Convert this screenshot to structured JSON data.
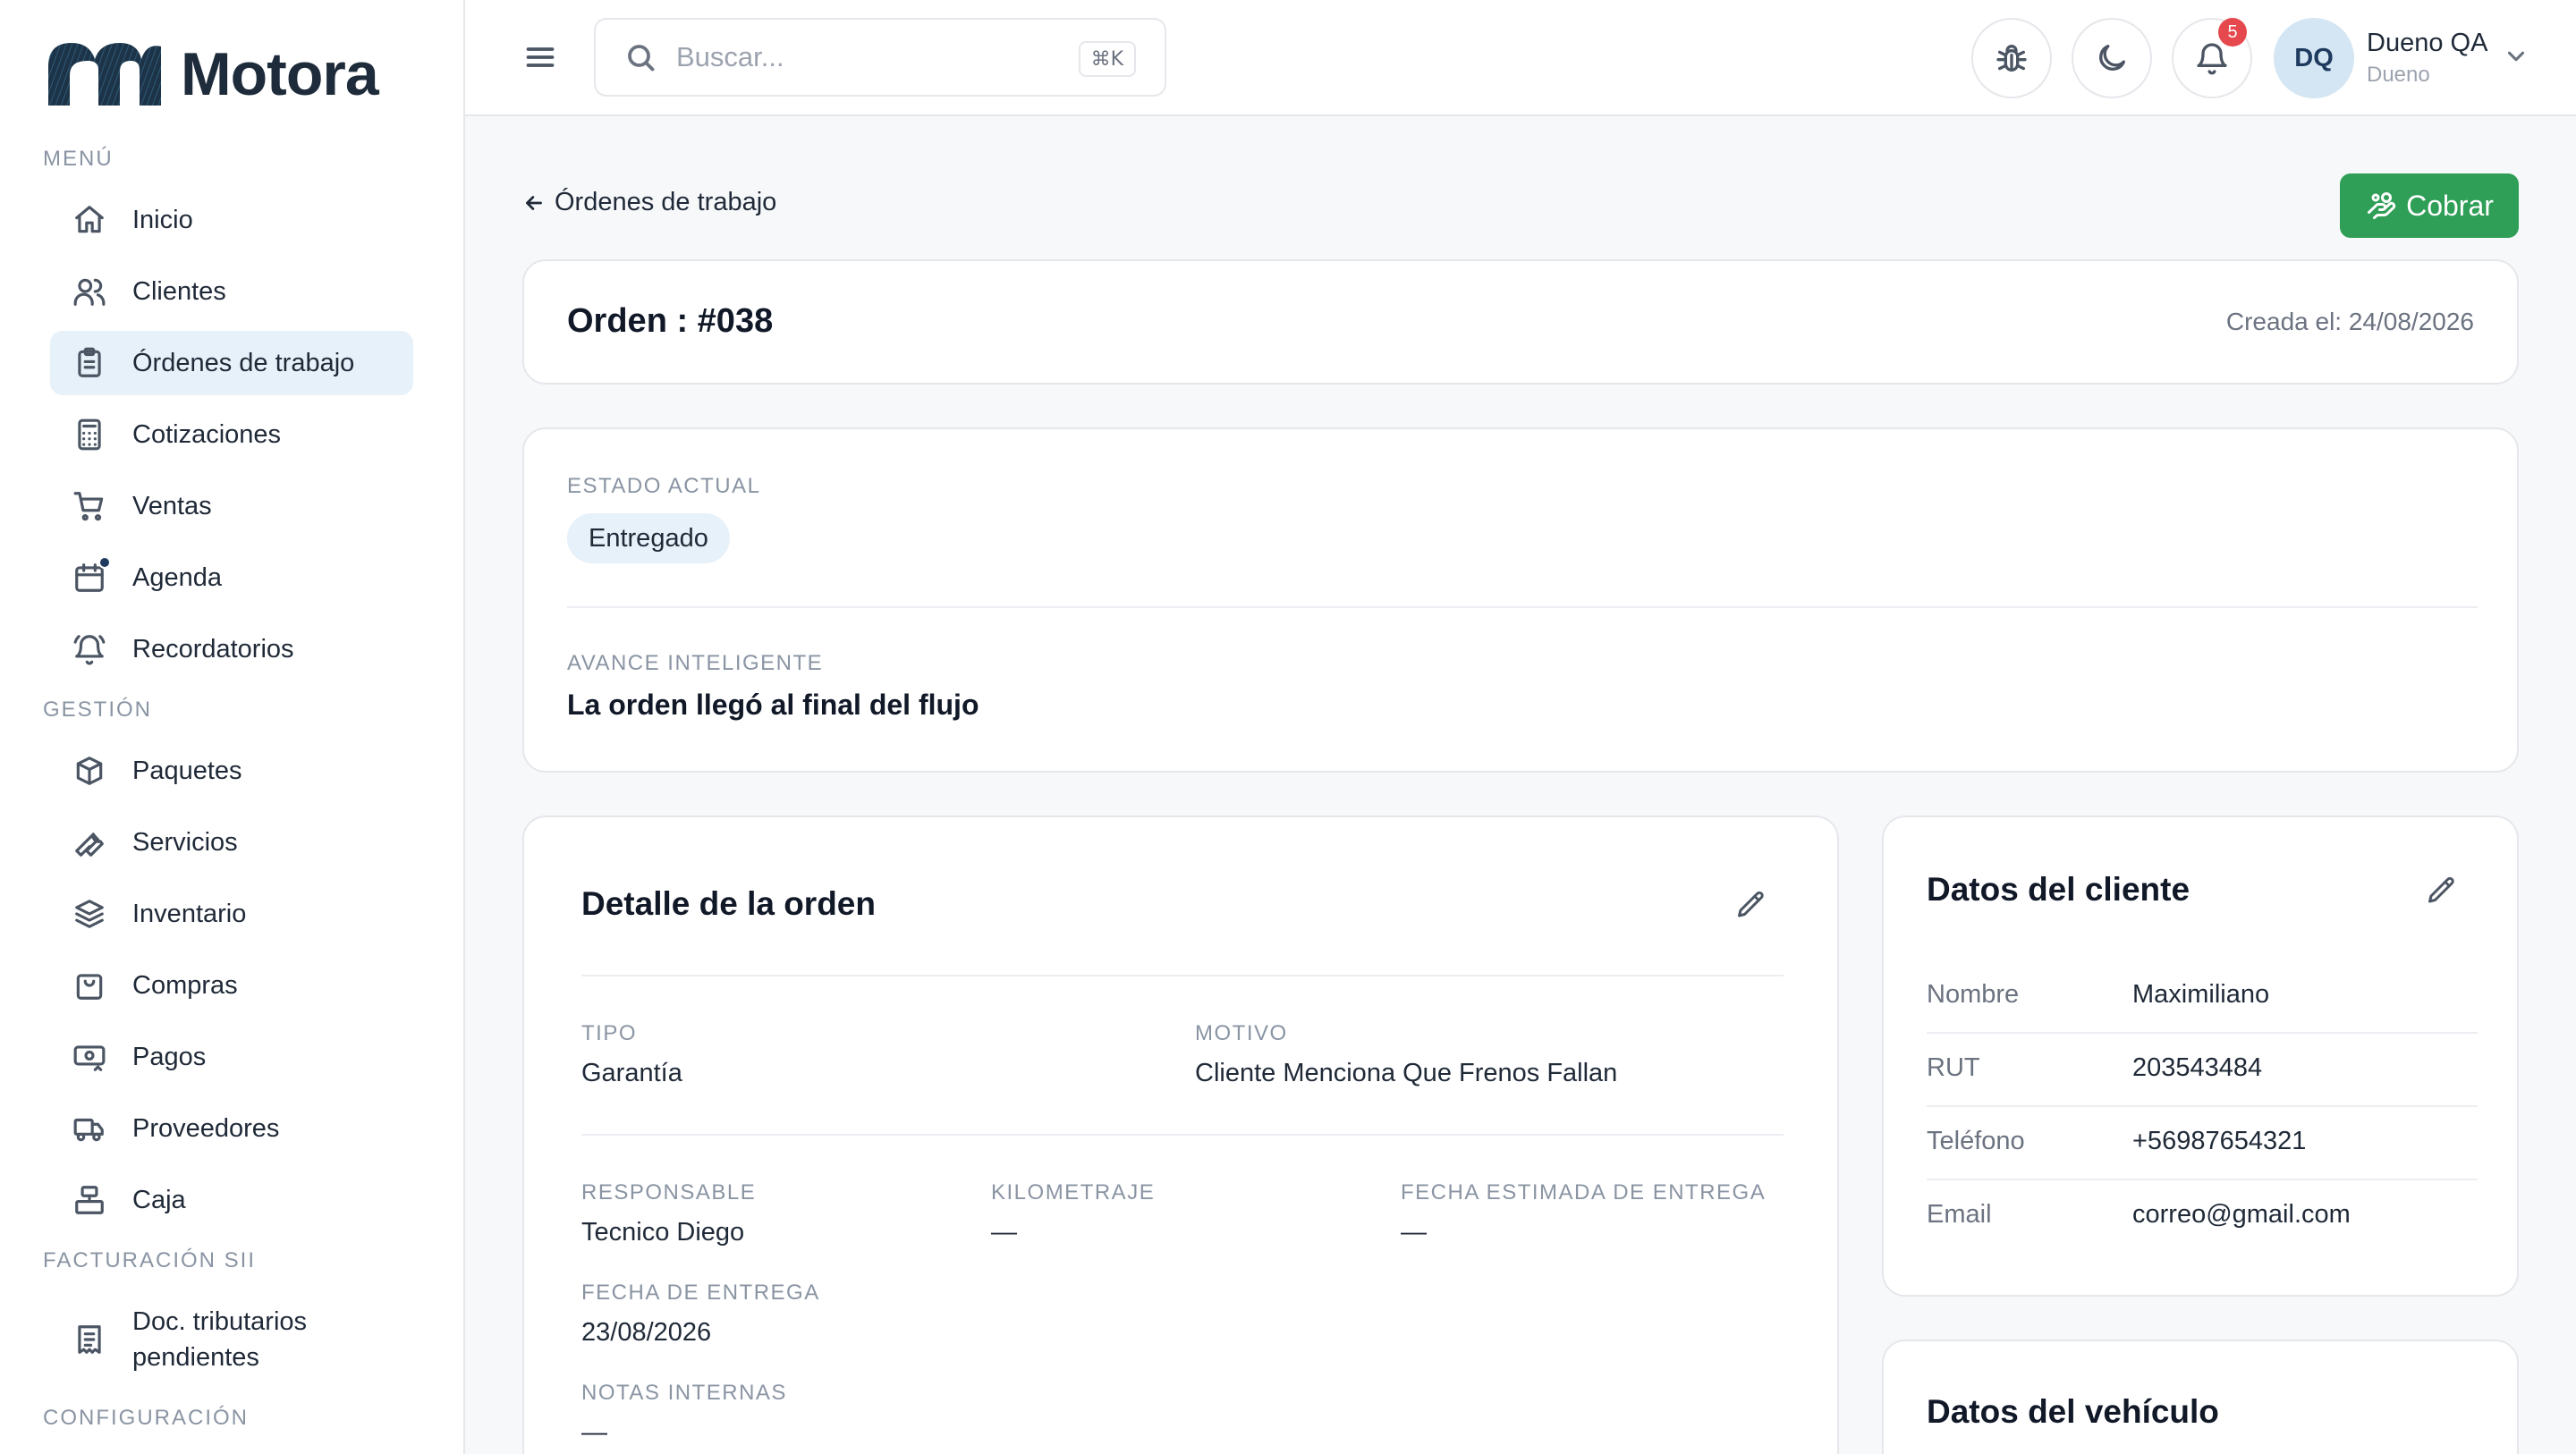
{
  "brand": {
    "name": "Motora"
  },
  "sidebar": {
    "sections": {
      "menu": "MENÚ",
      "gestion": "GESTIÓN",
      "facturacion": "FACTURACIÓN SII",
      "configuracion": "CONFIGURACIÓN"
    },
    "items": [
      {
        "label": "Inicio",
        "icon": "home-icon"
      },
      {
        "label": "Clientes",
        "icon": "users-icon"
      },
      {
        "label": "Órdenes de trabajo",
        "icon": "clipboard-icon"
      },
      {
        "label": "Cotizaciones",
        "icon": "calculator-icon"
      },
      {
        "label": "Ventas",
        "icon": "cart-icon"
      },
      {
        "label": "Agenda",
        "icon": "calendar-icon"
      },
      {
        "label": "Recordatorios",
        "icon": "bell-ring-icon"
      },
      {
        "label": "Paquetes",
        "icon": "package-icon"
      },
      {
        "label": "Servicios",
        "icon": "wrench-icon"
      },
      {
        "label": "Inventario",
        "icon": "boxes-icon"
      },
      {
        "label": "Compras",
        "icon": "shopping-bag-icon"
      },
      {
        "label": "Pagos",
        "icon": "payments-icon"
      },
      {
        "label": "Proveedores",
        "icon": "truck-icon"
      },
      {
        "label": "Caja",
        "icon": "register-icon"
      },
      {
        "label": "Doc. tributarios pendientes",
        "icon": "receipt-icon"
      }
    ],
    "active_index": 2
  },
  "header": {
    "search_placeholder": "Buscar...",
    "search_shortcut": "⌘K",
    "notifications_count": "5",
    "user": {
      "initials": "DQ",
      "name": "Dueno QA",
      "role": "Dueno"
    }
  },
  "main": {
    "back_label": "Órdenes de trabajo",
    "charge_button": "Cobrar",
    "order": {
      "title": "Orden : #038",
      "created": "Creada el: 24/08/2026"
    },
    "status": {
      "label": "ESTADO ACTUAL",
      "value": "Entregado",
      "progress_label": "AVANCE INTELIGENTE",
      "progress_text": "La orden llegó al final del flujo"
    },
    "detail": {
      "title": "Detalle de la orden",
      "tipo_label": "TIPO",
      "tipo": "Garantía",
      "motivo_label": "MOTIVO",
      "motivo": "Cliente Menciona Que Frenos Fallan",
      "responsable_label": "RESPONSABLE",
      "responsable": "Tecnico Diego",
      "kilometraje_label": "KILOMETRAJE",
      "kilometraje": "—",
      "fecha_estimada_label": "FECHA ESTIMADA DE ENTREGA",
      "fecha_estimada": "—",
      "fecha_entrega_label": "FECHA DE ENTREGA",
      "fecha_entrega": "23/08/2026",
      "notas_label": "NOTAS INTERNAS",
      "notas": "—"
    },
    "client": {
      "title": "Datos del cliente",
      "rows": [
        {
          "label": "Nombre",
          "value": "Maximiliano"
        },
        {
          "label": "RUT",
          "value": "203543484"
        },
        {
          "label": "Teléfono",
          "value": "+56987654321"
        },
        {
          "label": "Email",
          "value": "correo@gmail.com"
        }
      ]
    },
    "vehicle": {
      "title": "Datos del vehículo"
    }
  }
}
